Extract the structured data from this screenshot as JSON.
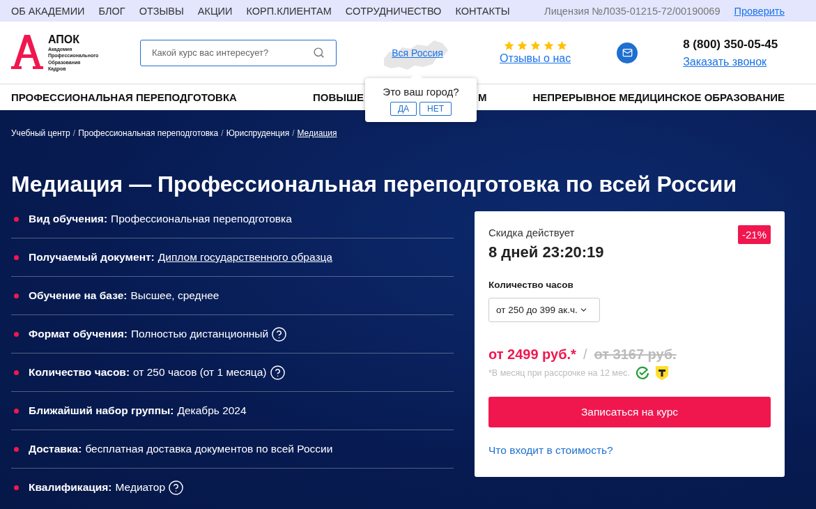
{
  "top_menu": [
    {
      "label": "ОБ АКАДЕМИИ"
    },
    {
      "label": "БЛОГ"
    },
    {
      "label": "ОТЗЫВЫ"
    },
    {
      "label": "АКЦИИ"
    },
    {
      "label": "КОРП.КЛИЕНТАМ"
    },
    {
      "label": "СОТРУДНИЧЕСТВО"
    },
    {
      "label": "КОНТАКТЫ"
    }
  ],
  "license": {
    "text": "Лицензия №Л035-01215-72/00190069",
    "link": "Проверить"
  },
  "logo": {
    "name": "АПОК",
    "lines": [
      "Академия",
      "Профессионального",
      "Образования",
      "Кадров"
    ]
  },
  "search": {
    "placeholder": "Какой курс вас интересует?"
  },
  "region": {
    "link": "Вся Россия",
    "popup": {
      "question": "Это ваш город?",
      "buttons": [
        "ДА",
        "НЕТ"
      ]
    }
  },
  "reviews": {
    "stars": 5,
    "link": "Отзывы о нас"
  },
  "contact": {
    "phone": "8 (800) 350-05-45",
    "callback": "Заказать звонок"
  },
  "main_nav": [
    {
      "parts": [
        "ПРОФЕССИОНАЛЬНАЯ ПЕРЕПОДГОТОВКА"
      ]
    },
    {
      "parts": [
        "ПОВЫШЕ",
        "М"
      ]
    },
    {
      "parts": [
        "НЕПРЕРЫВНОЕ МЕДИЦИНСКОЕ ОБРАЗОВАНИЕ"
      ]
    }
  ],
  "breadcrumb_separator": "/",
  "breadcrumbs": [
    {
      "label": "Учебный центр",
      "current": false
    },
    {
      "label": "Профессиональная переподготовка",
      "current": false
    },
    {
      "label": "Юриспруденция",
      "current": false
    },
    {
      "label": "Медиация",
      "current": true
    }
  ],
  "title": "Медиация — Профессиональная переподготовка по всей России",
  "facts": [
    {
      "label": "Вид обучения:",
      "value": "Профессиональная переподготовка",
      "link": false,
      "help": false
    },
    {
      "label": "Получаемый документ:",
      "value": "Диплом государственного образца",
      "link": true,
      "help": false
    },
    {
      "label": "Обучение на базе:",
      "value": "Высшее, среднее",
      "link": false,
      "help": false
    },
    {
      "label": "Формат обучения:",
      "value": "Полностью дистанционный",
      "link": false,
      "help": true
    },
    {
      "label": "Количество часов:",
      "value": "от 250 часов (от 1 месяца)",
      "link": false,
      "help": true
    },
    {
      "label": "Ближайший набор группы:",
      "value": "Декабрь 2024",
      "link": false,
      "help": false
    },
    {
      "label": "Доставка:",
      "value": "бесплатная доставка документов по всей России",
      "link": false,
      "help": false
    },
    {
      "label": "Квалификация:",
      "value": "Медиатор",
      "link": false,
      "help": true
    }
  ],
  "offer": {
    "discount_label": "Скидка действует",
    "countdown": "8 дней 23:20:19",
    "discount": "-21%",
    "hours_label": "Количество часов",
    "hours_value": "от 250 до 399 ак.ч.",
    "price": "от 2499 руб.*",
    "separator": "/",
    "old_price": "от 3167 руб.",
    "installment": "*В месяц при рассрочке на 12 мес.",
    "button": "Записаться на курс",
    "includes_link": "Что входит в стоимость?"
  }
}
